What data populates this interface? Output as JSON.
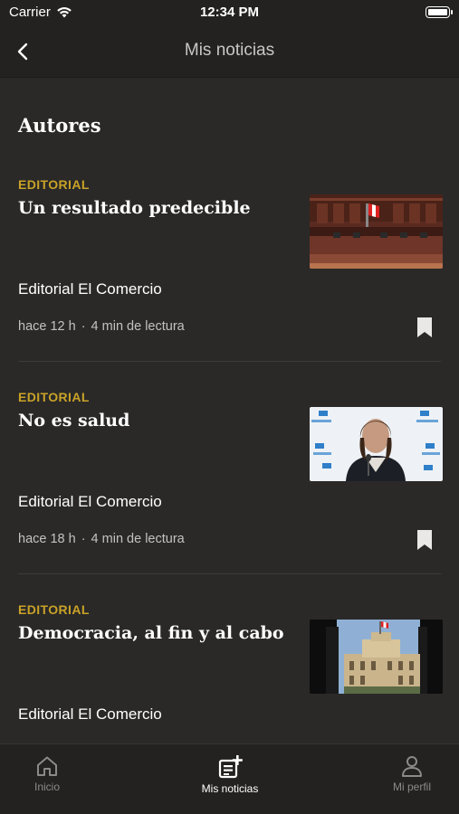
{
  "status_bar": {
    "carrier": "Carrier",
    "time": "12:34 PM"
  },
  "nav": {
    "title": "Mis noticias",
    "back_icon": "chevron-left-icon"
  },
  "section": {
    "title": "Autores"
  },
  "articles": [
    {
      "category": "EDITORIAL",
      "headline": "Un resultado predecible",
      "author": "Editorial El Comercio",
      "time": "hace 12 h",
      "separator": "·",
      "reading": "4 min de lectura",
      "image": "congress-chamber-photo"
    },
    {
      "category": "EDITORIAL",
      "headline": "No es salud",
      "author": "Editorial El Comercio",
      "time": "hace 18 h",
      "separator": "·",
      "reading": "4 min de lectura",
      "image": "press-conference-essalud-photo"
    },
    {
      "category": "EDITORIAL",
      "headline": "Democracia, al fin y al cabo",
      "author": "Editorial El Comercio",
      "image": "government-palace-photo"
    }
  ],
  "tabs": [
    {
      "label": "Inicio",
      "icon": "home-icon"
    },
    {
      "label": "Mis noticias",
      "icon": "news-add-icon"
    },
    {
      "label": "Mi perfil",
      "icon": "user-icon"
    }
  ],
  "colors": {
    "background": "#2a2928",
    "accent": "#c9a227",
    "bar": "#232221"
  }
}
